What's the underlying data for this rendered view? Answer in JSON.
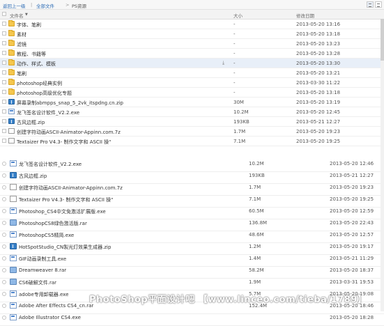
{
  "breadcrumb": {
    "back": "返回上一级",
    "sep": "|",
    "all_files": "全部文件",
    "arrow": ">",
    "current": "PS资源"
  },
  "header": {
    "name": "文件名",
    "sort_arrow": "▼",
    "size": "大小",
    "date": "修改日期"
  },
  "upper_rows": [
    {
      "icon": "folder",
      "name": "字体、笔刷",
      "size": "-",
      "date": "2013-05-20 13:16"
    },
    {
      "icon": "folder",
      "name": "素材",
      "size": "-",
      "date": "2013-05-20 13:18"
    },
    {
      "icon": "folder",
      "name": "滤镜",
      "size": "-",
      "date": "2013-05-20 13:23"
    },
    {
      "icon": "folder",
      "name": "教程、书籍等",
      "size": "-",
      "date": "2013-05-20 13:28"
    },
    {
      "icon": "folder",
      "name": "动作、样式、模板",
      "size": "-",
      "date": "2013-05-20 13:30",
      "highlight": true,
      "download": "⤓"
    },
    {
      "icon": "folder",
      "name": "笔刷",
      "size": "-",
      "date": "2013-05-20 13:21"
    },
    {
      "icon": "folder",
      "name": "photoshop经典实例",
      "size": "-",
      "date": "2013-03-30 11:22"
    },
    {
      "icon": "folder",
      "name": "photoshop高级优化专题",
      "size": "-",
      "date": "2013-05-20 13:18"
    },
    {
      "icon": "zip",
      "name": "屏幕录制abmpps_snap_5_2vk_itspdng.cn.zip",
      "size": "30M",
      "date": "2013-05-20 13:19"
    },
    {
      "icon": "exe",
      "name": "龙飞签名设计软件_V2.2.exe",
      "size": "10.2M",
      "date": "2013-05-20 12:45"
    },
    {
      "icon": "zip",
      "name": "古风边框.zip",
      "size": "193KB",
      "date": "2013-05-21 12:27"
    },
    {
      "icon": "doc",
      "name": "创建字符动画ASCII-Animator-Appinn.com.7z",
      "size": "1.7M",
      "date": "2013-05-20 19:23"
    },
    {
      "icon": "doc",
      "name": "Textaizer Pro V4.3- 制作文字和 ASCII 操\"",
      "size": "7.1M",
      "date": "2013-05-20 19:25"
    }
  ],
  "lower_rows": [
    {
      "icon": "exe",
      "name": "龙飞签名设计软件_V2.2.exe",
      "size": "10.2M",
      "date": "2013-05-20 12:46"
    },
    {
      "icon": "zip",
      "name": "古风边框.zip",
      "size": "193KB",
      "date": "2013-05-21 12:27"
    },
    {
      "icon": "doc",
      "name": "创建字符动画ASCII-Animator-Appinn.com.7z",
      "size": "1.7M",
      "date": "2013-05-20 19:23"
    },
    {
      "icon": "doc",
      "name": "Textaizer Pro V4.3- 制作文字和 ASCII 操\"",
      "size": "7.1M",
      "date": "2013-05-20 19:25"
    },
    {
      "icon": "exe",
      "name": "Photoshop_CS4中文免激活扩展版.exe",
      "size": "60.5M",
      "date": "2013-05-20 12:59"
    },
    {
      "icon": "rar",
      "name": "PhotoshopCS8绿色激活版.rar",
      "size": "136.8M",
      "date": "2013-05-20 22:43"
    },
    {
      "icon": "exe",
      "name": "PhotoshopCS5精简.exe",
      "size": "48.6M",
      "date": "2013-05-20 12:57"
    },
    {
      "icon": "zip",
      "name": "HotSpotStudio_CN製光灯效果生成器.zip",
      "size": "1.2M",
      "date": "2013-05-20 19:17"
    },
    {
      "icon": "exe",
      "name": "GIF动画录制工具.exe",
      "size": "1.4M",
      "date": "2013-05-21 11:29"
    },
    {
      "icon": "rar",
      "name": "Dreamweaver 8.rar",
      "size": "58.2M",
      "date": "2013-05-20 18:37"
    },
    {
      "icon": "rar",
      "name": "CS6破解文件.rar",
      "size": "1.9M",
      "date": "2013-03-31 19:53"
    },
    {
      "icon": "exe",
      "name": "adobe专用卸载器.exe",
      "size": "5.7M",
      "date": "2013-05-20 19:08"
    },
    {
      "icon": "exe",
      "name": "Adobe After Effects CS4_cn.rar",
      "size": "152.4M",
      "date": "2013-05-20 18:46"
    },
    {
      "icon": "exe",
      "name": "Adobe Illustrator CS4.exe",
      "size": "",
      "date": "2013-05-20 18:28"
    }
  ],
  "watermark": "PhotoShop平面设计吧 【www.linceo.com/tieba/1789】",
  "colors": {
    "folder": "#f5c74e",
    "link": "#2d6cb5",
    "highlight": "#e8eff8"
  }
}
